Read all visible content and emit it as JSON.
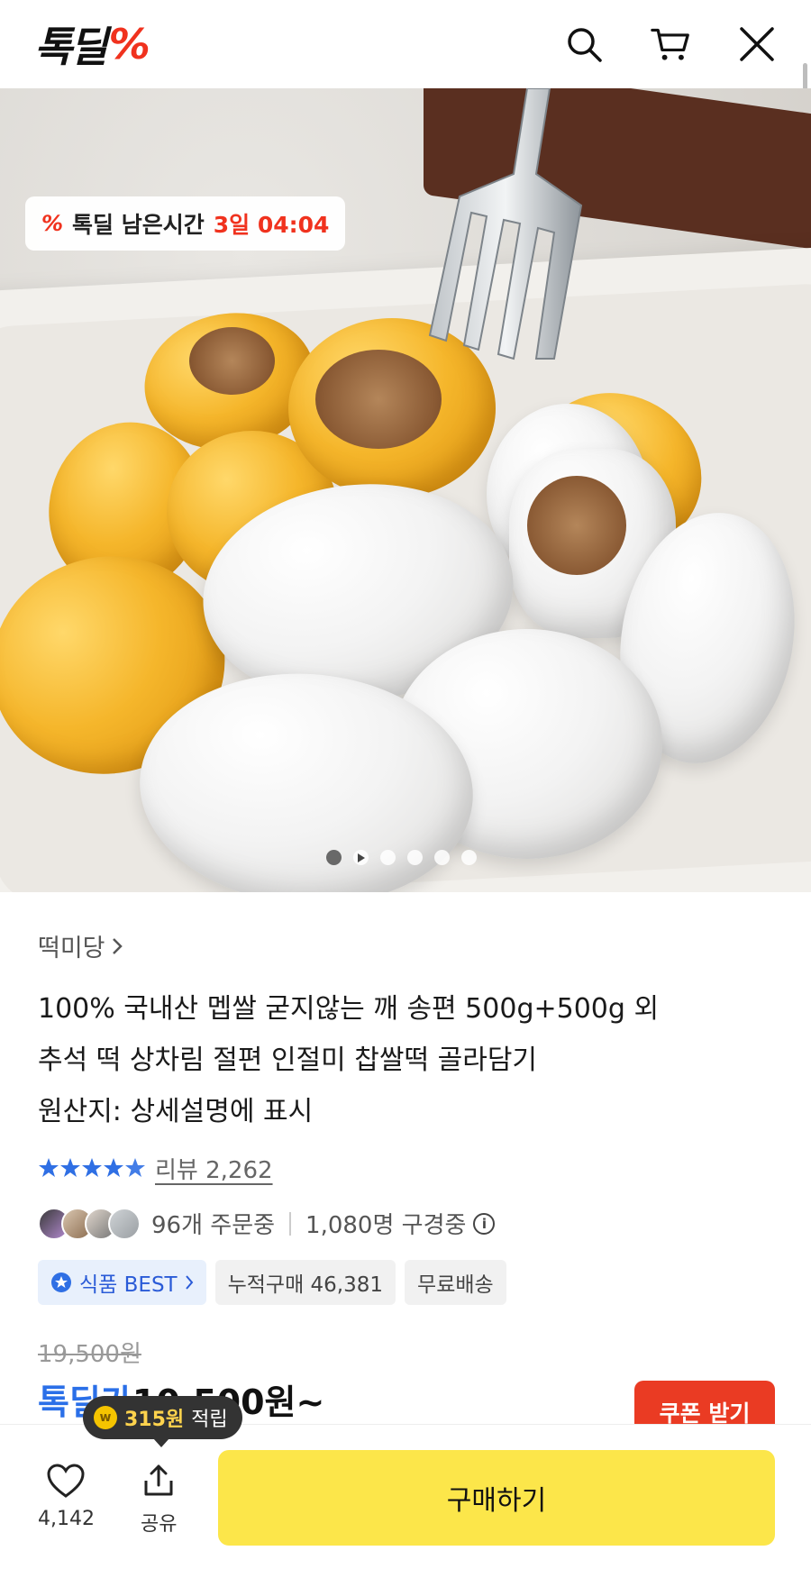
{
  "header": {
    "logo_text": "톡딜",
    "logo_mark": "%",
    "icons": [
      "search-icon",
      "cart-icon",
      "close-icon"
    ]
  },
  "hero": {
    "timer_label": "톡딜 남은시간",
    "timer_value": "3일 04:04",
    "slide_count": 6,
    "active_slide": 1
  },
  "product": {
    "brand": "떡미당",
    "title_lines": [
      "100% 국내산 멥쌀 굳지않는 깨 송편 500g+500g 외",
      "추석 떡 상차림 절편 인절미 찹쌀떡 골라담기",
      "원산지: 상세설명에 표시"
    ],
    "rating_stars": 4.5,
    "reviews": "리뷰 2,262",
    "orders": "96개 주문중",
    "viewers": "1,080명 구경중",
    "badges": {
      "best": "식품 BEST",
      "cumulative": "누적구매 46,381",
      "shipping": "무료배송"
    },
    "original_price": "19,500원",
    "deal_label": "톡딜가",
    "deal_price": "10,500원~",
    "coupon_button": "쿠폰 받기"
  },
  "bottom_bar": {
    "like_count": "4,142",
    "share_label": "공유",
    "buy_button": "구매하기",
    "points_amount": "315원",
    "points_label": "적립",
    "points_coin": "w"
  },
  "colors": {
    "accent_red": "#f0321e",
    "deal_blue": "#2a6fe8",
    "buy_yellow": "#fce64a",
    "coupon_red": "#ea3b23"
  }
}
